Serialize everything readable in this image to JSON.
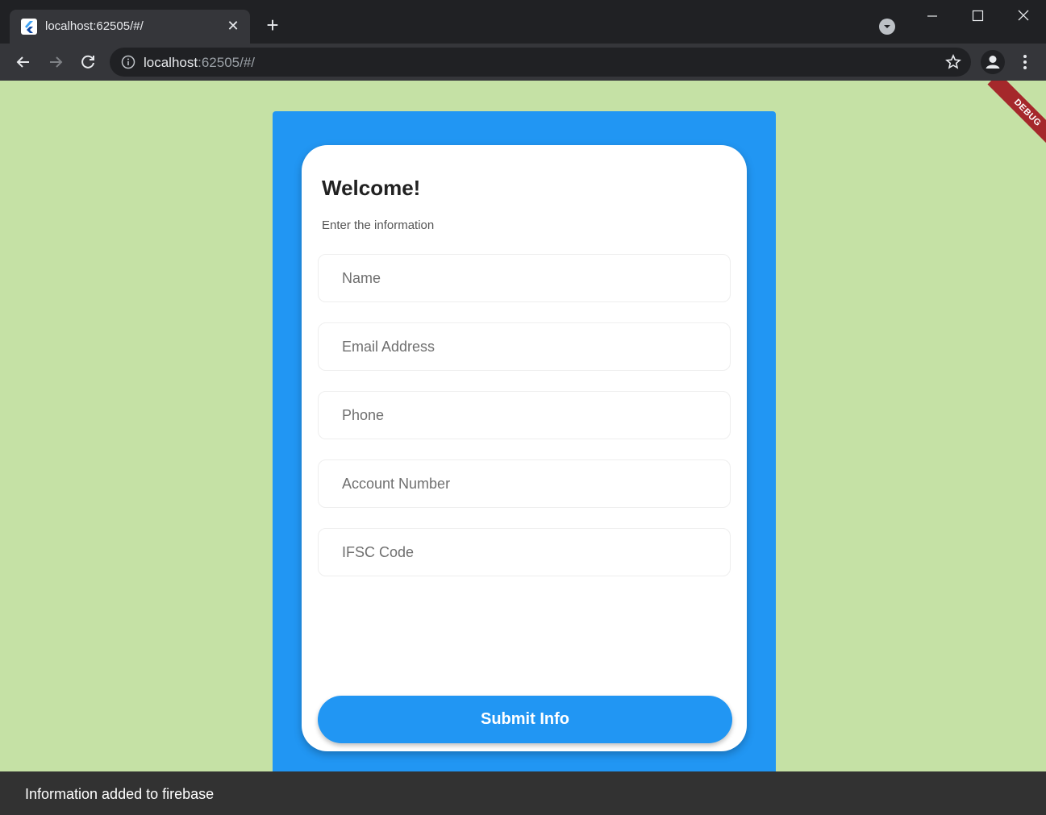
{
  "browser": {
    "tab_title": "localhost:62505/#/",
    "tab_close": "✕",
    "new_tab": "+",
    "url_host": "localhost",
    "url_rest": ":62505/#/",
    "icons": {
      "favicon": "flutter-icon",
      "back": "back-arrow-icon",
      "forward": "forward-arrow-icon",
      "reload": "reload-icon",
      "info": "info-icon",
      "star": "star-icon",
      "profile": "profile-icon",
      "menu": "kebab-menu-icon",
      "minimize": "minimize-icon",
      "maximize": "maximize-icon",
      "close": "close-icon"
    }
  },
  "page": {
    "debug_banner": "DEBUG",
    "title": "Welcome!",
    "subtitle": "Enter the information",
    "fields": [
      {
        "placeholder": "Name",
        "value": ""
      },
      {
        "placeholder": "Email Address",
        "value": ""
      },
      {
        "placeholder": "Phone",
        "value": ""
      },
      {
        "placeholder": "Account Number",
        "value": ""
      },
      {
        "placeholder": "IFSC Code",
        "value": ""
      }
    ],
    "submit_label": "Submit Info"
  },
  "snackbar": {
    "message": "Information added to firebase"
  },
  "colors": {
    "background": "#c5e1a5",
    "panel": "#2196f3",
    "button": "#2196f3",
    "debug_banner": "#a5282b",
    "snackbar": "#323232"
  }
}
